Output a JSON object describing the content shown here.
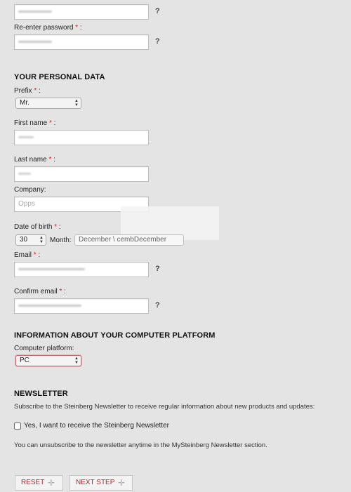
{
  "password": {
    "q": "?"
  },
  "reenter_password": {
    "label": "Re-enter password",
    "req": " *",
    "colon": " :",
    "q": "?"
  },
  "personal": {
    "title": "YOUR PERSONAL DATA",
    "prefix": {
      "label": "Prefix",
      "req": " *",
      "colon": " :",
      "value": "Mr."
    },
    "first_name": {
      "label": "First name",
      "req": " *",
      "colon": " :"
    },
    "last_name": {
      "label": "Last name",
      "req": " *",
      "colon": " :"
    },
    "company": {
      "label": "Company:",
      "value": "Opps"
    },
    "dob": {
      "label": "Date of birth",
      "req": " *",
      "colon": " :",
      "day": "30",
      "month_label": "Month:",
      "month_value": "December \\ cembDecember"
    },
    "email": {
      "label": "Email",
      "req": " *",
      "colon": " :",
      "q": "?"
    },
    "confirm_email": {
      "label": "Confirm email",
      "req": " *",
      "colon": " :",
      "q": "?"
    }
  },
  "platform": {
    "title": "INFORMATION ABOUT YOUR COMPUTER PLATFORM",
    "label": "Computer platform:",
    "value": "PC"
  },
  "newsletter": {
    "title": "NEWSLETTER",
    "intro": "Subscribe to the Steinberg Newsletter to receive regular information about new products and updates:",
    "checkbox_label": "Yes, I want to receive the Steinberg Newsletter",
    "unsubscribe": "You can unsubscribe to the newsletter anytime in the MySteinberg Newsletter section."
  },
  "buttons": {
    "reset": "RESET",
    "next": "NEXT STEP"
  },
  "icons": {
    "plus_cross": "✛",
    "spinner_up": "▲",
    "spinner_down": "▼"
  },
  "colors": {
    "required": "#c0282d",
    "button_text": "#b0272c",
    "select_highlight": "#c36a6e"
  }
}
